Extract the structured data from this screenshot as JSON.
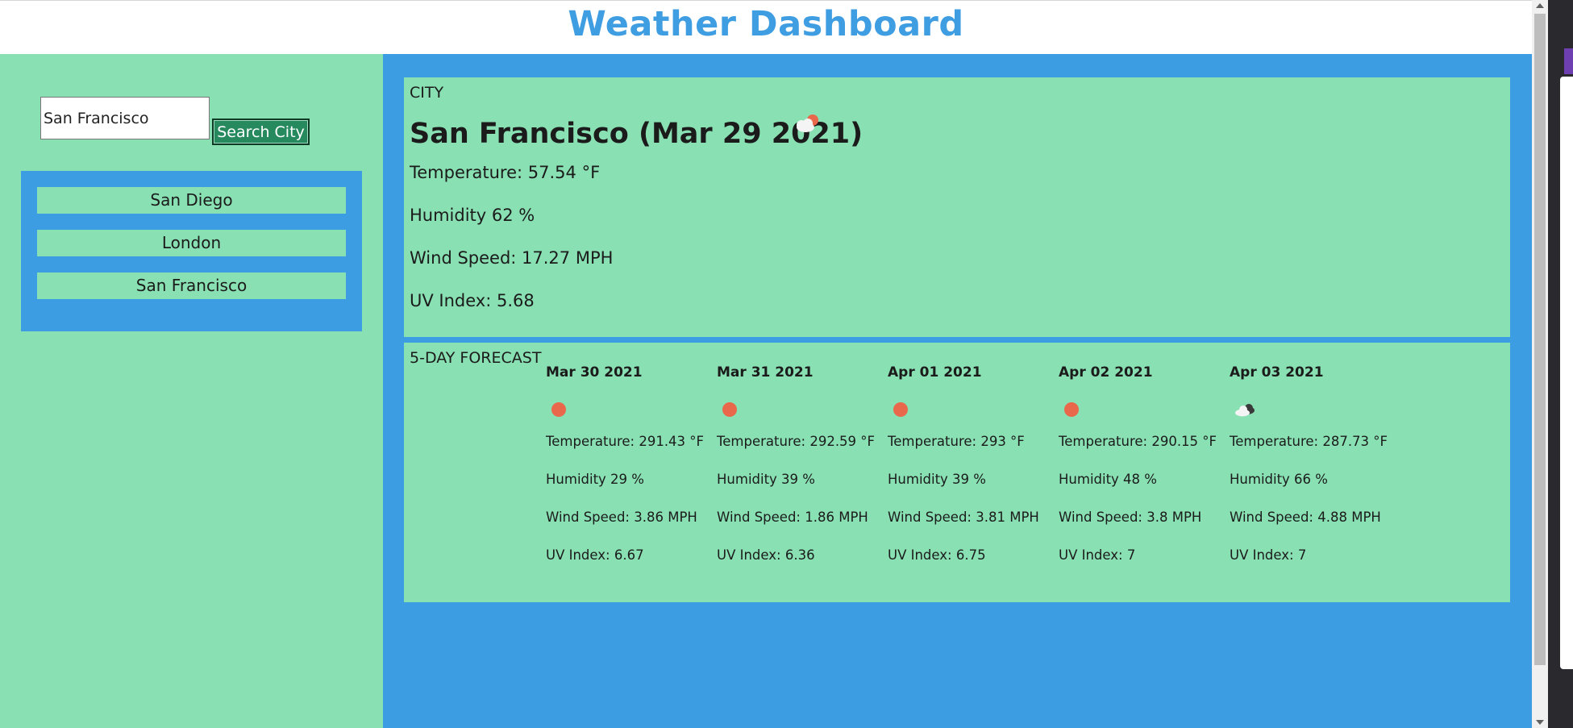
{
  "header": {
    "title": "Weather Dashboard"
  },
  "search": {
    "value": "San Francisco",
    "button_label": "Search City"
  },
  "history": [
    {
      "label": "San Diego"
    },
    {
      "label": "London"
    },
    {
      "label": "San Francisco"
    }
  ],
  "current": {
    "section_label": "CITY",
    "title": "San Francisco (Mar 29 2021)",
    "icon": "few-clouds-day-icon",
    "temperature": "Temperature: 57.54 °F",
    "humidity": "Humidity 62 %",
    "wind": "Wind Speed: 17.27 MPH",
    "uv": "UV Index: 5.68"
  },
  "forecast": {
    "section_label": "5-DAY FORECAST",
    "days": [
      {
        "date": "Mar 30 2021",
        "icon": "clear-sky-icon",
        "temperature": "Temperature: 291.43 °F",
        "humidity": "Humidity 29 %",
        "wind": "Wind Speed: 3.86 MPH",
        "uv": "UV Index: 6.67"
      },
      {
        "date": "Mar 31 2021",
        "icon": "clear-sky-icon",
        "temperature": "Temperature: 292.59 °F",
        "humidity": "Humidity 39 %",
        "wind": "Wind Speed: 1.86 MPH",
        "uv": "UV Index: 6.36"
      },
      {
        "date": "Apr 01 2021",
        "icon": "clear-sky-icon",
        "temperature": "Temperature: 293 °F",
        "humidity": "Humidity 39 %",
        "wind": "Wind Speed: 3.81 MPH",
        "uv": "UV Index: 6.75"
      },
      {
        "date": "Apr 02 2021",
        "icon": "clear-sky-icon",
        "temperature": "Temperature: 290.15 °F",
        "humidity": "Humidity 48 %",
        "wind": "Wind Speed: 3.8 MPH",
        "uv": "UV Index: 7"
      },
      {
        "date": "Apr 03 2021",
        "icon": "broken-clouds-icon",
        "temperature": "Temperature: 287.73 °F",
        "humidity": "Humidity 66 %",
        "wind": "Wind Speed: 4.88 MPH",
        "uv": "UV Index: 7"
      }
    ]
  },
  "colors": {
    "title": "#3f9de2",
    "panel_blue": "#3d9de2",
    "panel_green": "#88e0b3",
    "button_green": "#278a5f",
    "sun": "#e9674a"
  }
}
